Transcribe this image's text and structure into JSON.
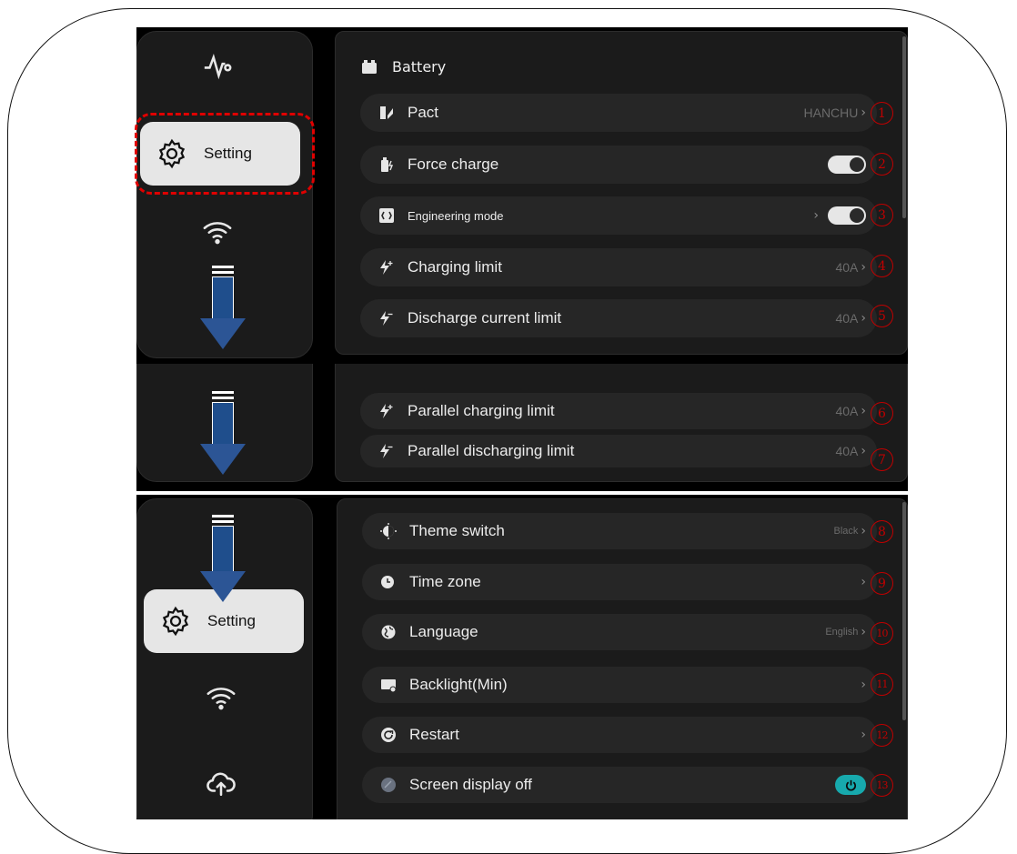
{
  "nav": {
    "setting_label": "Setting"
  },
  "battery_section": {
    "title": "Battery",
    "rows": [
      {
        "label": "Pact",
        "value": "HANCHU",
        "badge": "1"
      },
      {
        "label": "Force charge",
        "badge": "2",
        "toggle": "off"
      },
      {
        "label": "Engineering mode",
        "badge": "3",
        "toggle": "off"
      },
      {
        "label": "Charging limit",
        "value": "40A",
        "badge": "4"
      },
      {
        "label": "Discharge current limit",
        "value": "40A",
        "badge": "5"
      }
    ]
  },
  "parallel_section": {
    "rows": [
      {
        "label": "Parallel charging limit",
        "value": "40A",
        "badge": "6"
      },
      {
        "label": "Parallel discharging limit",
        "value": "40A",
        "badge": "7"
      }
    ]
  },
  "system_section": {
    "rows": [
      {
        "label": "Theme switch",
        "value": "Black",
        "badge": "8"
      },
      {
        "label": "Time zone",
        "value": "",
        "badge": "9"
      },
      {
        "label": "Language",
        "value": "English",
        "badge": "10"
      },
      {
        "label": "Backlight(Min)",
        "value": "",
        "badge": "11"
      },
      {
        "label": "Restart",
        "value": "",
        "badge": "12"
      },
      {
        "label": "Screen display off",
        "badge": "13",
        "toggle": "on"
      }
    ]
  },
  "colors": {
    "highlight": "#e00000",
    "badge": "#c00000",
    "arrow": "#1f4e8c",
    "power_toggle": "#17a9ad"
  }
}
